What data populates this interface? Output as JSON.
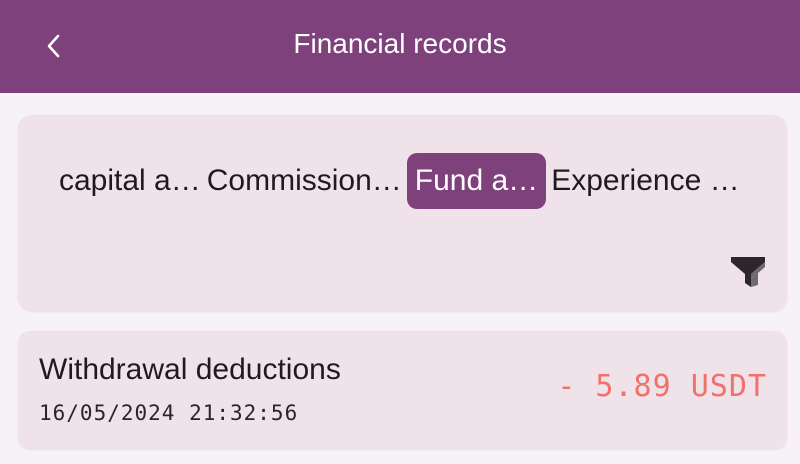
{
  "header": {
    "title": "Financial records",
    "back_icon": "chevron-left-icon",
    "background_color": "#7f417c"
  },
  "filter": {
    "tabs": [
      {
        "label": "capital a…",
        "active": false
      },
      {
        "label": "Commission…",
        "active": false
      },
      {
        "label": "Fund a…",
        "active": true
      },
      {
        "label": "Experience …",
        "active": false
      }
    ],
    "filter_icon": "funnel-icon",
    "active_color": "#7f417c"
  },
  "records": [
    {
      "type": "Withdrawal deductions",
      "time": "16/05/2024 21:32:56",
      "amount": "- 5.89 USDT",
      "amount_color": "#f2706d"
    }
  ]
}
